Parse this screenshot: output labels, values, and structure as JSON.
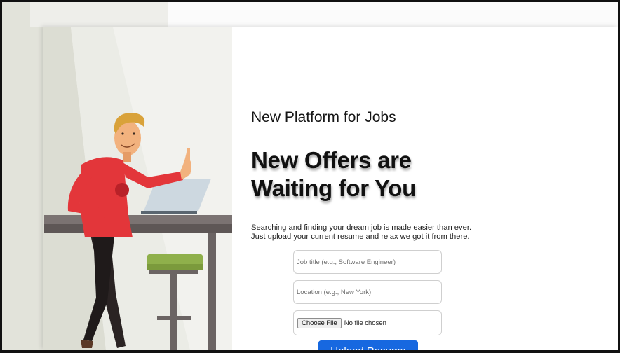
{
  "hero": {
    "subtitle": "New Platform for Jobs",
    "headline_line1": "New Offers are",
    "headline_line2": "Waiting for You",
    "description_line1": "Searching and finding your dream job is made easier than ever.",
    "description_line2": "Just upload your current resume and relax we got it from there."
  },
  "form": {
    "job_title_placeholder": "Job title (e.g., Software Engineer)",
    "location_placeholder": "Location (e.g., New York)",
    "choose_file_label": "Choose File",
    "no_file_text": "No file chosen",
    "upload_label": "Upload Resume"
  },
  "colors": {
    "accent": "#1768e0",
    "shirt": "#e3363a",
    "hair": "#d9a23a"
  }
}
